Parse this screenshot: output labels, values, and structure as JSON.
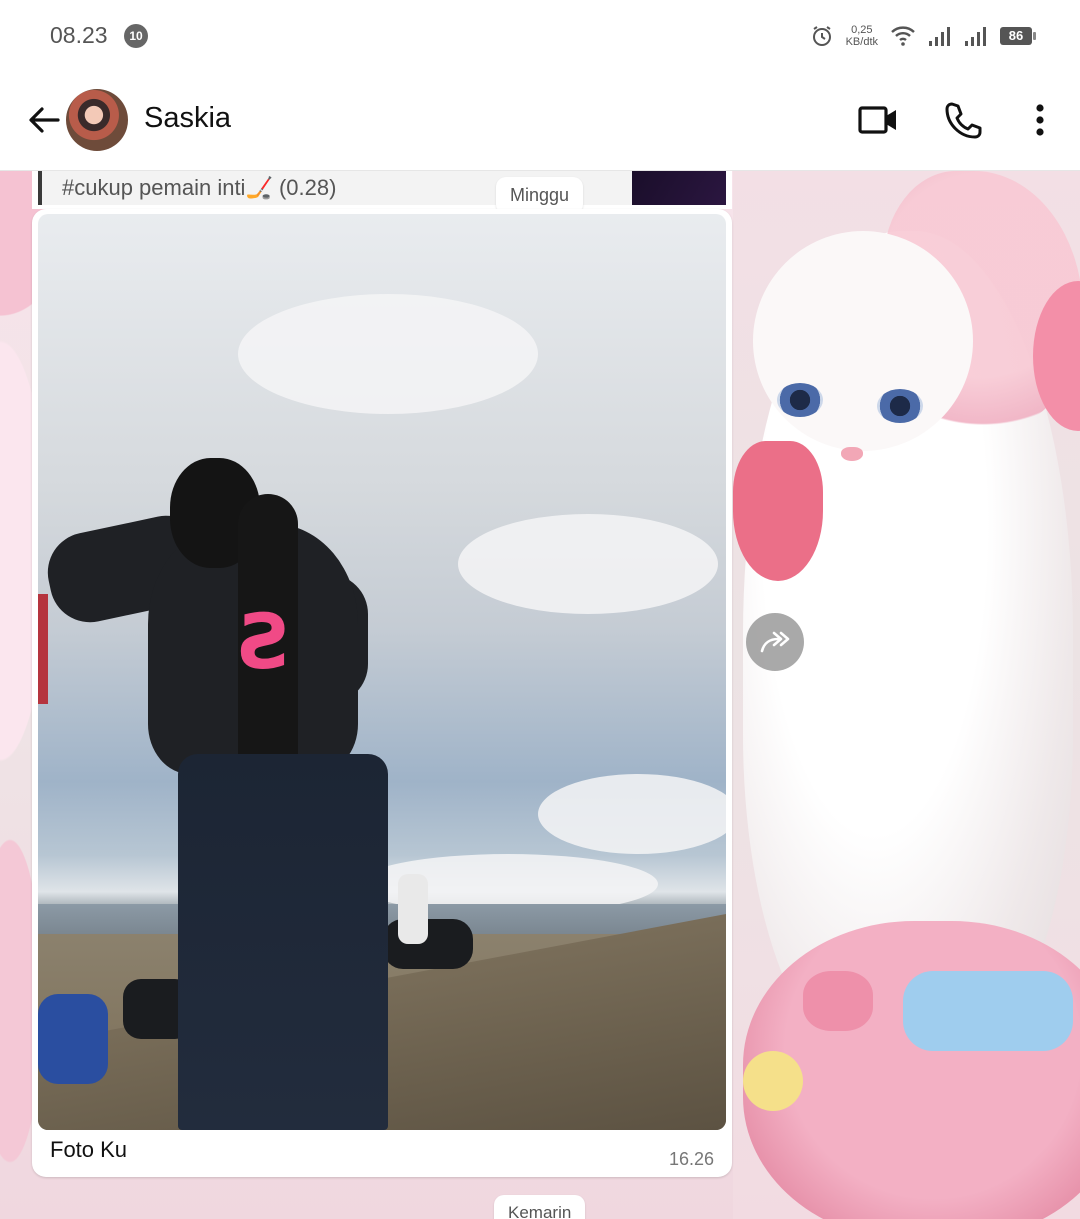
{
  "status_bar": {
    "time": "08.23",
    "notification_badge": "10",
    "net_speed_value": "0,25",
    "net_speed_unit": "KB/dtk",
    "battery": "86"
  },
  "header": {
    "contact_name": "Saskia"
  },
  "chat": {
    "previous_message_text": "#cukup pemain inti🏒 (0.28)",
    "date_separator": "Minggu",
    "image_message": {
      "caption": "Foto Ku",
      "time": "16.26"
    },
    "next_date_separator": "Kemarin"
  }
}
